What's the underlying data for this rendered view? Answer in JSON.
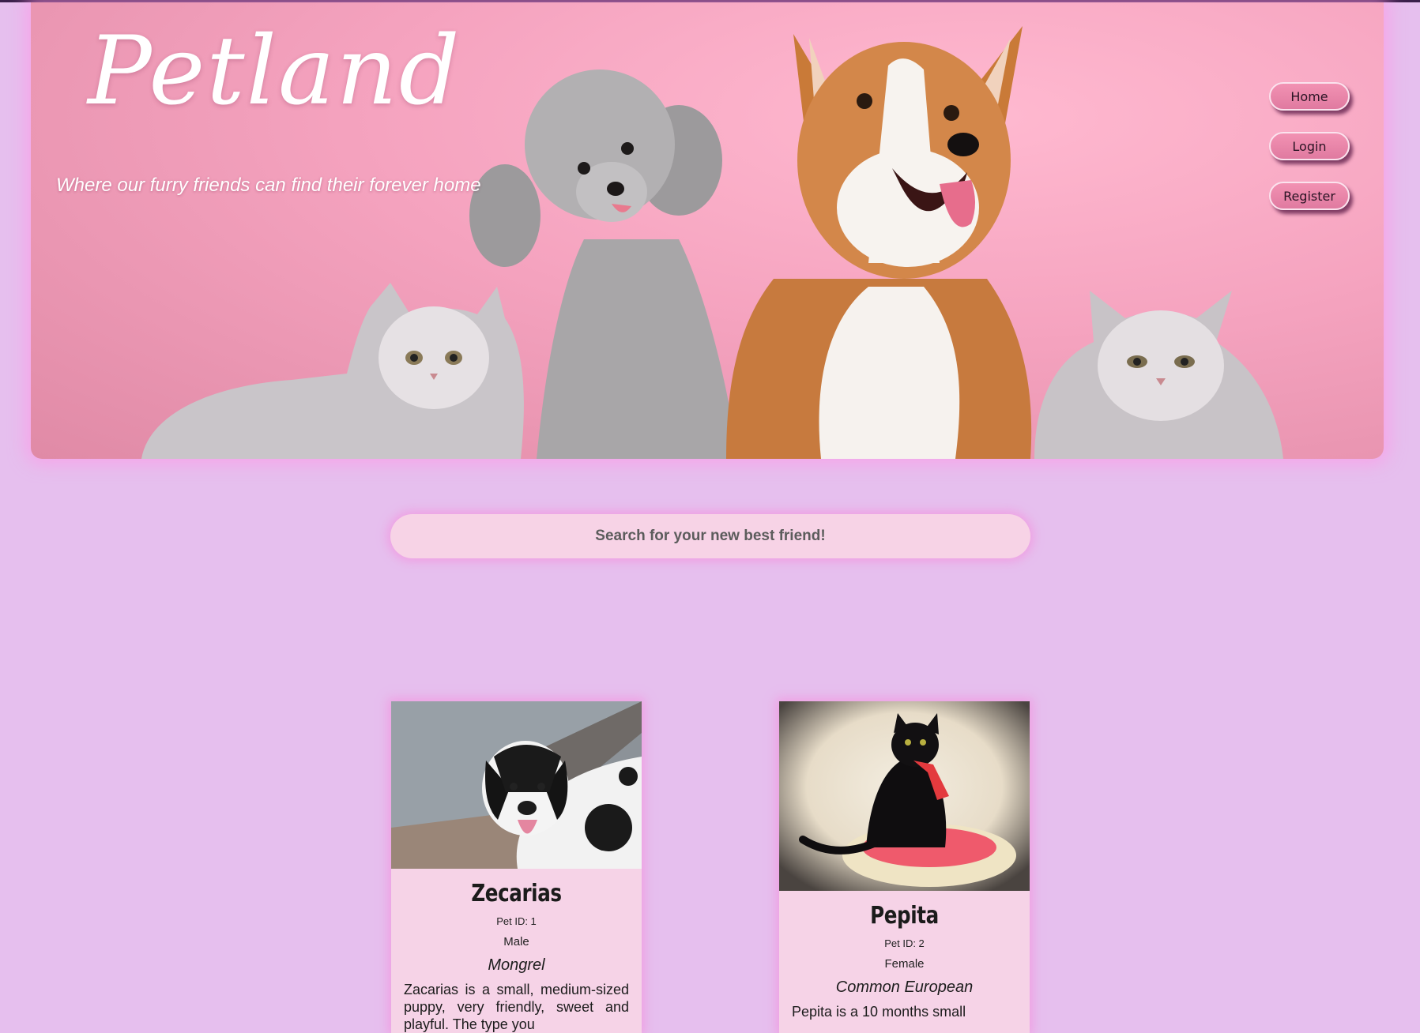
{
  "header": {
    "title": "Petland",
    "tagline": "Where our furry friends can find their forever home"
  },
  "nav": {
    "home_label": "Home",
    "login_label": "Login",
    "register_label": "Register"
  },
  "search": {
    "placeholder": "Search for your new best friend!"
  },
  "pets": [
    {
      "name": "Zecarias",
      "pet_id": "Pet ID: 1",
      "sex": "Male",
      "breed": "Mongrel",
      "description": "Zacarias is a small, medium-sized puppy, very friendly, sweet and playful. The type you"
    },
    {
      "name": "Pepita",
      "pet_id": "Pet ID: 2",
      "sex": "Female",
      "breed": "Common European",
      "description": "Pepita is a 10 months small"
    }
  ],
  "colors": {
    "page_background": "#e6bfee",
    "hero_background": "#f5a3bf",
    "nav_button": "#e985a9",
    "card_background": "#f6d3e7",
    "glow": "#f58cdc"
  }
}
